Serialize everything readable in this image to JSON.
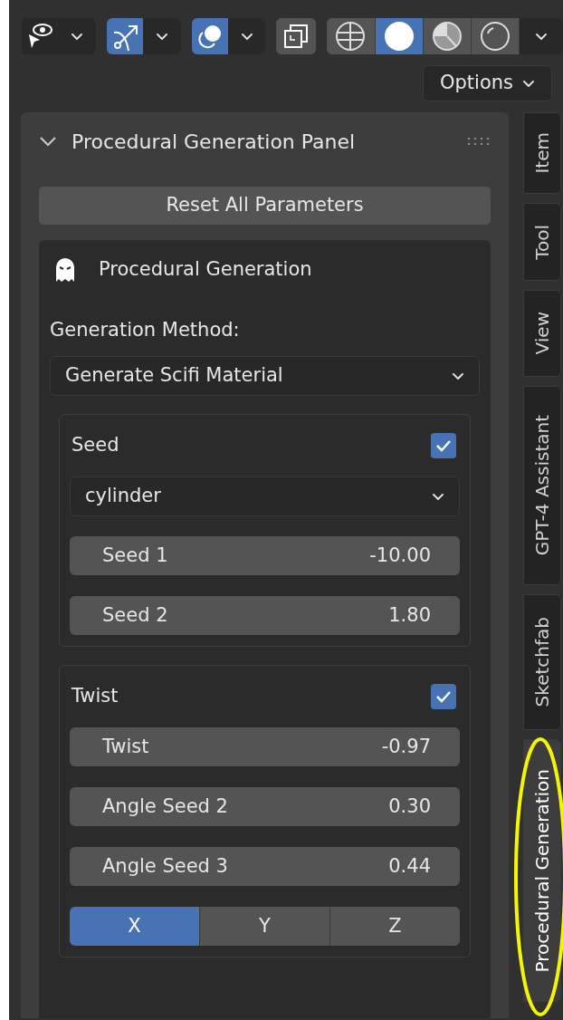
{
  "toolbar": {
    "select_toggle": {
      "selected": false
    },
    "gizmo_toggle": {
      "selected": true
    },
    "overlay_toggle": {
      "selected": true
    },
    "xray_toggle": {
      "selected": false
    },
    "shading_modes": [
      {
        "kind": "wireframe",
        "selected": false
      },
      {
        "kind": "solid",
        "selected": true
      },
      {
        "kind": "material",
        "selected": false
      },
      {
        "kind": "rendered",
        "selected": false
      }
    ]
  },
  "options_button": "Options",
  "panel": {
    "title": "Procedural Generation Panel",
    "expanded": true,
    "reset_button": "Reset All Parameters",
    "section": {
      "title": "Procedural Generation",
      "method_label": "Generation Method:",
      "method_value": "Generate Scifi Material",
      "groups": [
        {
          "title": "Seed",
          "checked": true,
          "dropdown": "cylinder",
          "fields": [
            {
              "label": "Seed 1",
              "value": "-10.00"
            },
            {
              "label": "Seed 2",
              "value": "1.80"
            }
          ]
        },
        {
          "title": "Twist",
          "checked": true,
          "fields": [
            {
              "label": "Twist",
              "value": "-0.97"
            },
            {
              "label": "Angle Seed 2",
              "value": "0.30"
            },
            {
              "label": "Angle Seed 3",
              "value": "0.44"
            }
          ],
          "axes": [
            {
              "label": "X",
              "selected": true
            },
            {
              "label": "Y",
              "selected": false
            },
            {
              "label": "Z",
              "selected": false
            }
          ]
        }
      ]
    }
  },
  "side_tabs": [
    {
      "label": "Item",
      "selected": false
    },
    {
      "label": "Tool",
      "selected": false
    },
    {
      "label": "View",
      "selected": false
    },
    {
      "label": "GPT-4 Assistant",
      "selected": false
    },
    {
      "label": "Sketchfab",
      "selected": false
    },
    {
      "label": "Procedural Generation",
      "selected": true
    }
  ]
}
